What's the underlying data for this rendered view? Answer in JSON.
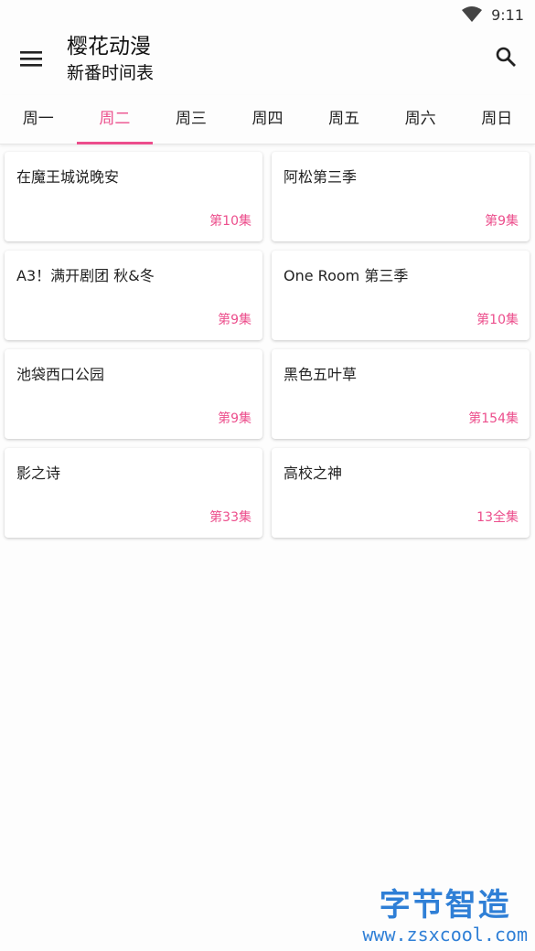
{
  "status": {
    "time": "9:11"
  },
  "header": {
    "title": "樱花动漫",
    "subtitle": "新番时间表"
  },
  "tabs": [
    "周一",
    "周二",
    "周三",
    "周四",
    "周五",
    "周六",
    "周日"
  ],
  "active_tab": "周二",
  "accent_color": "#ec4e8c",
  "cards": [
    {
      "title": "在魔王城说晚安",
      "episode": "第10集"
    },
    {
      "title": "阿松第三季",
      "episode": "第9集"
    },
    {
      "title": "A3！满开剧团 秋&冬",
      "episode": "第9集"
    },
    {
      "title": "One Room 第三季",
      "episode": "第10集"
    },
    {
      "title": "池袋西口公园",
      "episode": "第9集"
    },
    {
      "title": "黑色五叶草",
      "episode": "第154集"
    },
    {
      "title": "影之诗",
      "episode": "第33集"
    },
    {
      "title": "高校之神",
      "episode": "13全集"
    }
  ],
  "watermark": {
    "text": "字节智造",
    "url": "www.zsxcool.com"
  }
}
